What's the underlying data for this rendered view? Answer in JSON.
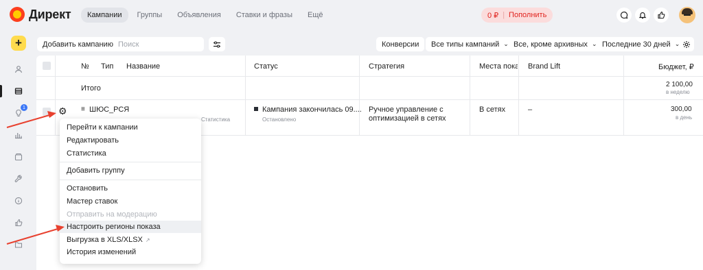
{
  "header": {
    "logo_text": "Директ",
    "nav": [
      "Кампании",
      "Группы",
      "Объявления",
      "Ставки и фразы",
      "Ещё"
    ],
    "balance": "0 ₽",
    "topup_label": "Пополнить",
    "icons": [
      "chat-icon",
      "bell-icon",
      "thumbs-up-icon"
    ]
  },
  "sidebar": {
    "add_label": "+",
    "badge": "1",
    "icons": [
      "person-icon",
      "campaigns-icon",
      "lightbulb-icon",
      "stats-icon",
      "box-icon",
      "wrench-icon",
      "info-icon",
      "like-icon",
      "folder-icon"
    ]
  },
  "toolbar": {
    "add_campaign": "Добавить кампанию",
    "search_placeholder": "Поиск",
    "conversions": "Конверсии",
    "campaign_types": "Все типы кампаний",
    "archive_filter": "Все, кроме архивных",
    "period": "Последние 30 дней"
  },
  "table": {
    "headers": {
      "num": "№",
      "type": "Тип",
      "name": "Название",
      "status": "Статус",
      "strategy": "Стратегия",
      "places": "Места показа",
      "brand_lift": "Brand Lift",
      "budget": "Бюджет, ₽"
    },
    "total": {
      "label": "Итого",
      "budget": "2 100,00",
      "budget_period": "в неделю"
    },
    "rows": [
      {
        "name": "ШЮС_РСЯ",
        "name_sub": "Статистика",
        "status": "Кампания закончилась 09....",
        "status_sub": "Остановлено",
        "strategy_line1": "Ручное управление с",
        "strategy_line2": "оптимизацией в сетях",
        "places": "В сетях",
        "brand_lift": "–",
        "budget": "300,00",
        "budget_period": "в день"
      }
    ]
  },
  "menu": {
    "items": [
      {
        "label": "Перейти к кампании",
        "disabled": false
      },
      {
        "label": "Редактировать",
        "disabled": false
      },
      {
        "label": "Статистика",
        "disabled": false
      },
      {
        "label": "Добавить группу",
        "disabled": false
      },
      {
        "label": "Остановить",
        "disabled": false
      },
      {
        "label": "Мастер ставок",
        "disabled": false
      },
      {
        "label": "Отправить на модерацию",
        "disabled": true
      },
      {
        "label": "Настроить регионы показа",
        "disabled": false,
        "highlighted": true
      },
      {
        "label": "Выгрузка в XLS/XLSX",
        "disabled": false
      },
      {
        "label": "История изменений",
        "disabled": false
      }
    ]
  },
  "colors": {
    "accent_yellow": "#ffdb4d",
    "topup_bg": "#fbdcdc",
    "topup_text": "#e0221d",
    "arrow": "#e8412f"
  }
}
